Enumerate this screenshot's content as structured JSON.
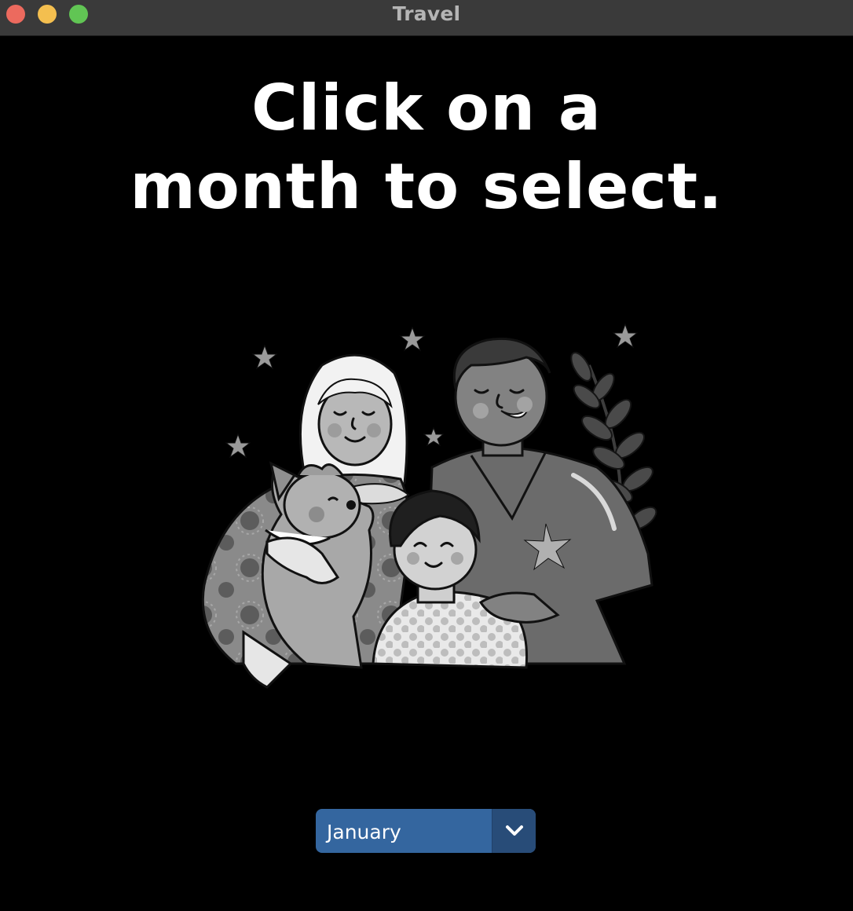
{
  "window": {
    "title": "Travel"
  },
  "main": {
    "heading_line1": "Click on a",
    "heading_line2": "month to select.",
    "illustration": "family-with-dog-illustration"
  },
  "month_select": {
    "selected": "January",
    "icon": "chevron-down-icon"
  },
  "colors": {
    "background": "#000000",
    "titlebar": "#3a3a3a",
    "select_bg": "#34669f",
    "select_arrow_bg": "#284c78",
    "close": "#ec6a5e",
    "minimize": "#f4bf4f",
    "zoom": "#61c554"
  }
}
